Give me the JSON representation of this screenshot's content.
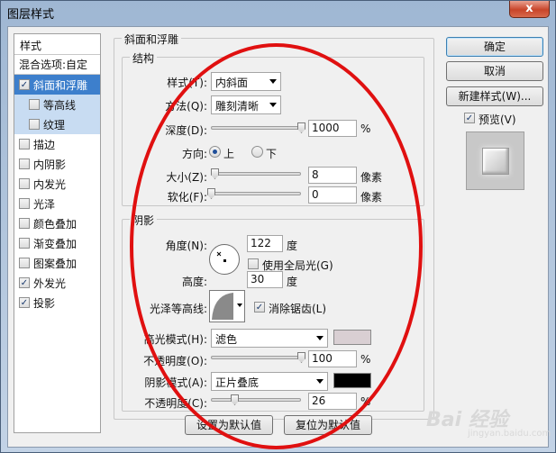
{
  "window": {
    "title": "图层样式",
    "close_glyph": "x"
  },
  "sidebar": {
    "header": "样式",
    "items": [
      {
        "label": "混合选项:自定",
        "checkbox": false,
        "checked": false
      },
      {
        "label": "斜面和浮雕",
        "checkbox": true,
        "checked": true
      },
      {
        "label": "等高线",
        "checkbox": true,
        "checked": false
      },
      {
        "label": "纹理",
        "checkbox": true,
        "checked": false
      },
      {
        "label": "描边",
        "checkbox": true,
        "checked": false
      },
      {
        "label": "内阴影",
        "checkbox": true,
        "checked": false
      },
      {
        "label": "内发光",
        "checkbox": true,
        "checked": false
      },
      {
        "label": "光泽",
        "checkbox": true,
        "checked": false
      },
      {
        "label": "颜色叠加",
        "checkbox": true,
        "checked": false
      },
      {
        "label": "渐变叠加",
        "checkbox": true,
        "checked": false
      },
      {
        "label": "图案叠加",
        "checkbox": true,
        "checked": false
      },
      {
        "label": "外发光",
        "checkbox": true,
        "checked": true
      },
      {
        "label": "投影",
        "checkbox": true,
        "checked": true
      }
    ]
  },
  "bevel": {
    "title": "斜面和浮雕",
    "structure": {
      "title": "结构",
      "style_label": "样式(T):",
      "style_value": "内斜面",
      "technique_label": "方法(Q):",
      "technique_value": "雕刻清晰",
      "depth_label": "深度(D):",
      "depth_value": "1000",
      "depth_unit": "%",
      "depth_level": 1.0,
      "direction_label": "方向:",
      "direction_up": "上",
      "direction_down": "下",
      "size_label": "大小(Z):",
      "size_value": "8",
      "size_unit": "像素",
      "size_level": 0.04,
      "soften_label": "软化(F):",
      "soften_value": "0",
      "soften_unit": "像素",
      "soften_level": 0.0
    },
    "shading": {
      "title": "阴影",
      "angle_label": "角度(N):",
      "angle_value": "122",
      "angle_unit": "度",
      "global_light_label": "使用全局光(G)",
      "altitude_label": "高度:",
      "altitude_value": "30",
      "altitude_unit": "度",
      "gloss_label": "光泽等高线:",
      "antialias_label": "消除锯齿(L)",
      "highlight_label": "高光模式(H):",
      "highlight_mode": "滤色",
      "highlight_color": "#d9cfd3",
      "highlight_opacity_label": "不透明度(O):",
      "highlight_opacity": "100",
      "highlight_opacity_unit": "%",
      "highlight_opacity_level": 1.0,
      "shadow_label": "阴影模式(A):",
      "shadow_mode": "正片叠底",
      "shadow_color": "#000000",
      "shadow_opacity_label": "不透明度(C):",
      "shadow_opacity": "26",
      "shadow_opacity_unit": "%",
      "shadow_opacity_level": 0.26
    },
    "make_default": "设置为默认值",
    "reset_default": "复位为默认值"
  },
  "actions": {
    "ok": "确定",
    "cancel": "取消",
    "new_style": "新建样式(W)...",
    "preview": "预览(V)"
  },
  "watermark": {
    "logo": "Bai 经验",
    "url": "jingyan.baidu.com"
  }
}
